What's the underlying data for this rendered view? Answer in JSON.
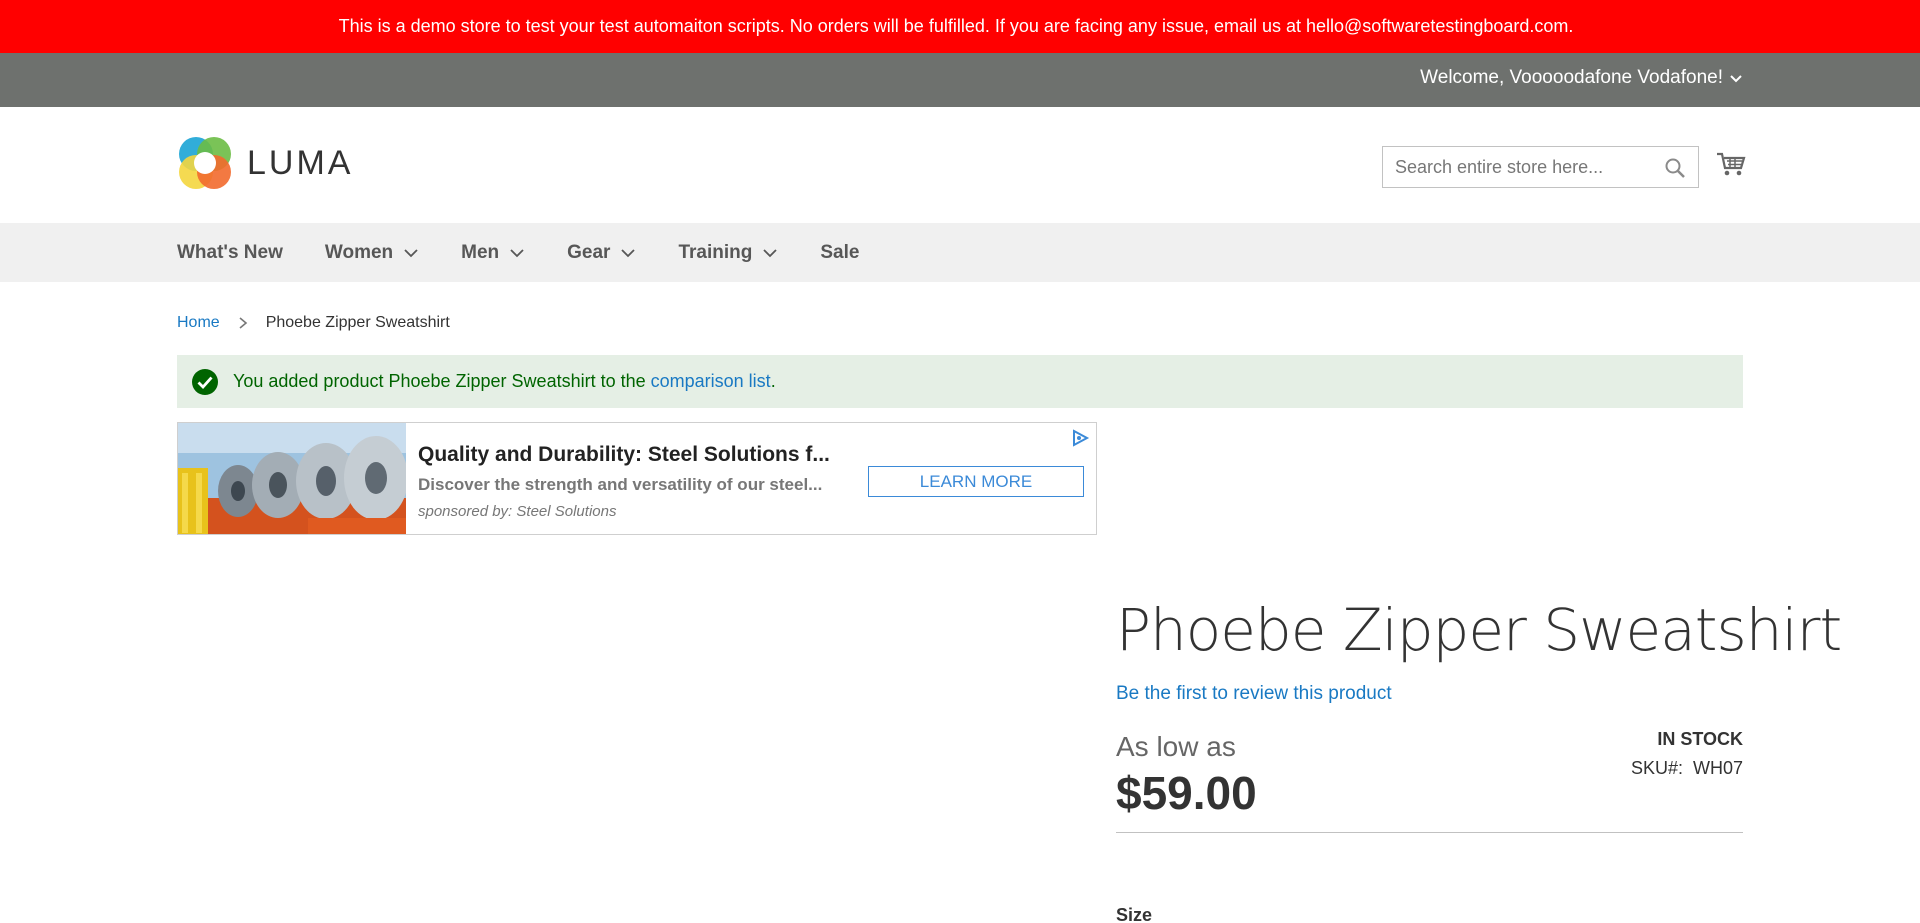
{
  "demo_notice": "This is a demo store to test your test automaiton scripts. No orders will be fulfilled. If you are facing any issue, email us at hello@softwaretestingboard.com.",
  "header": {
    "welcome_text": "Welcome, Vooooodafone Vodafone!",
    "logo_text": "LUMA",
    "search_placeholder": "Search entire store here..."
  },
  "nav": {
    "items": [
      {
        "label": "What's New"
      },
      {
        "label": "Women"
      },
      {
        "label": "Men"
      },
      {
        "label": "Gear"
      },
      {
        "label": "Training"
      },
      {
        "label": "Sale"
      }
    ]
  },
  "breadcrumb": {
    "home": "Home",
    "current": "Phoebe Zipper Sweatshirt"
  },
  "message": {
    "prefix": "You added product Phoebe Zipper Sweatshirt to the ",
    "link": "comparison list",
    "suffix": "."
  },
  "ad": {
    "title": "Quality and Durability: Steel Solutions f...",
    "description": "Discover the strength and versatility of our steel...",
    "sponsor": "sponsored by: Steel Solutions",
    "button": "LEARN MORE"
  },
  "product": {
    "title": "Phoebe Zipper Sweatshirt",
    "review_link": "Be the first to review this product",
    "as_low_as": "As low as",
    "price": "$59.00",
    "stock": "IN STOCK",
    "sku_label": "SKU#:",
    "sku": "WH07",
    "size_label": "Size"
  },
  "colors": {
    "demo_bar": "#ff0000",
    "welcome_bar": "#6e716e",
    "link": "#1979c3",
    "success_bg": "#e5efe5",
    "success_text": "#006400"
  }
}
